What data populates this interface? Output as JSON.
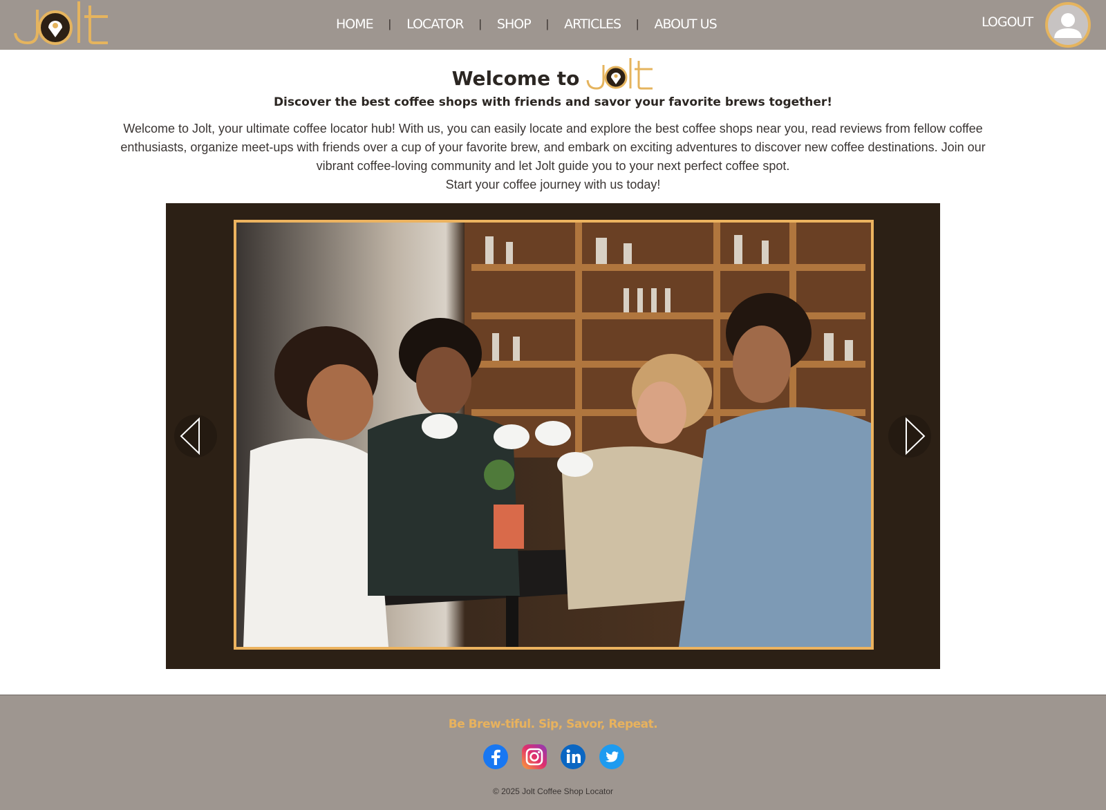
{
  "brand": {
    "logo_text": "Jolt",
    "accent_color": "#e5b45e",
    "header_bg": "#9e9690",
    "carousel_bg": "#2c2015"
  },
  "nav": {
    "items": [
      "HOME",
      "LOCATOR",
      "SHOP",
      "ARTICLES",
      "ABOUT US"
    ],
    "separator": "|",
    "logout_label": "LOGOUT"
  },
  "hero": {
    "welcome": "Welcome to",
    "subtitle": "Discover the best coffee shops with friends and savor your favorite brews together!",
    "description": "Welcome to Jolt, your ultimate coffee locator hub! With us, you can easily locate and explore the best coffee shops near you, read reviews from fellow coffee enthusiasts, organize meet-ups with friends over a cup of your favorite brew, and embark on exciting adventures to discover new coffee destinations. Join our vibrant coffee-loving community and let Jolt guide you to your next perfect coffee spot.",
    "cta_line": "Start your coffee journey with us today!"
  },
  "carousel": {
    "image_icon": "friends-toasting-coffee-photo",
    "prev_icon": "chevron-left-icon",
    "next_icon": "chevron-right-icon"
  },
  "footer": {
    "tagline": "Be Brew-tiful. Sip, Savor, Repeat.",
    "socials": [
      "facebook-icon",
      "instagram-icon",
      "linkedin-icon",
      "twitter-icon"
    ],
    "copyright": "© 2025 Jolt Coffee Shop Locator"
  }
}
